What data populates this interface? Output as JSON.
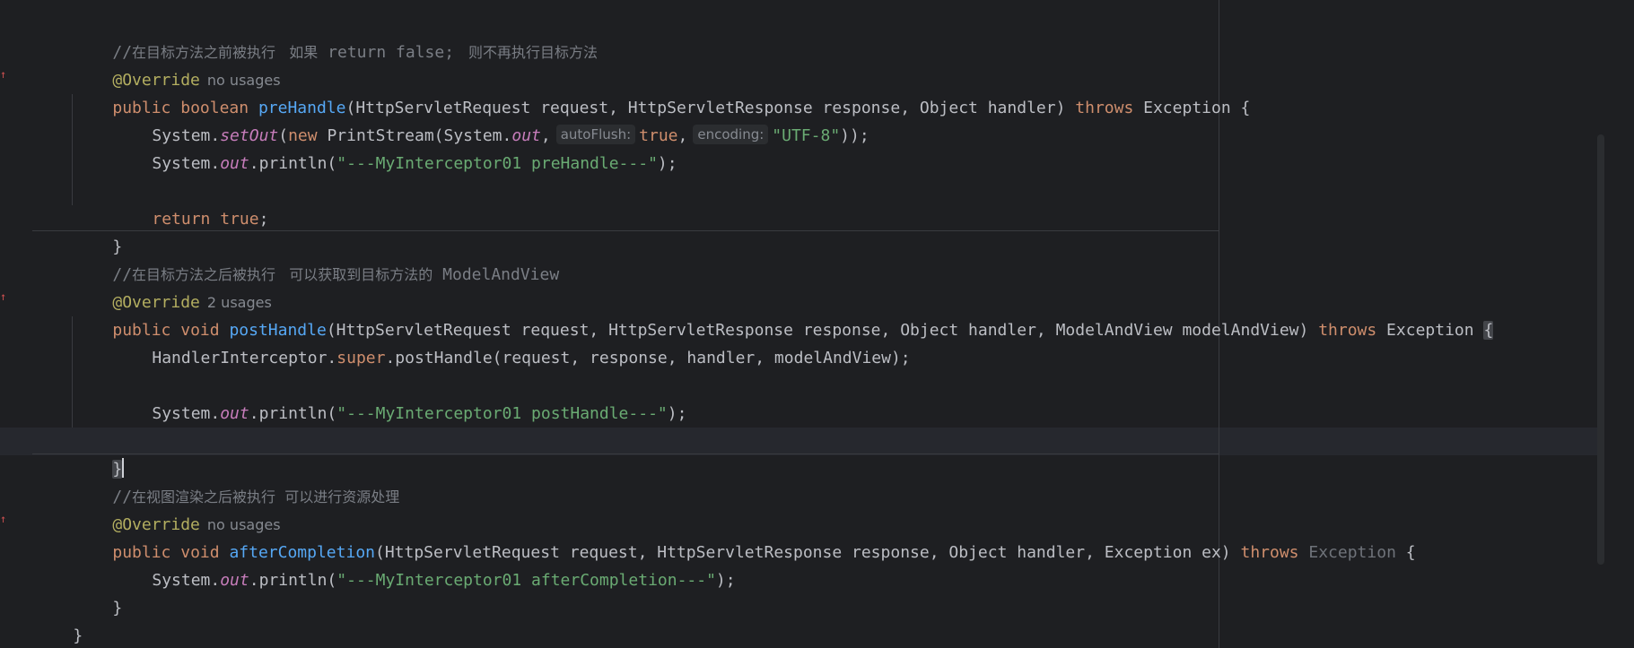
{
  "editor": {
    "lines": {
      "l1_comment_slashes": "//",
      "l1_comment_a": "在目标方法之前被执行   如果",
      "l1_comment_code": " return false; ",
      "l1_comment_b": " 则不再执行目标方法",
      "l2_annotation": "@Override",
      "l2_usage": "no usages",
      "l3_kw_public": "public",
      "l3_kw_boolean": "boolean",
      "l3_method": "preHandle",
      "l3_params": "(HttpServletRequest request, HttpServletResponse response, Object handler) ",
      "l3_throws": "throws",
      "l3_tail": " Exception {",
      "l4_a": "System.",
      "l4_setout": "setOut",
      "l4_b": "(",
      "l4_new": "new",
      "l4_c": " PrintStream(System.",
      "l4_out": "out",
      "l4_d": ",",
      "l4_hint1": "autoFlush:",
      "l4_true": "true",
      "l4_e": ",",
      "l4_hint2": "encoding:",
      "l4_str": "\"UTF-8\"",
      "l4_f": "));",
      "l5_a": "System.",
      "l5_out": "out",
      "l5_b": ".println(",
      "l5_str": "\"---MyInterceptor01 preHandle---\"",
      "l5_c": ");",
      "l7_return": "return",
      "l7_true": "true",
      "l7_semi": ";",
      "l8_brace": "}",
      "l9_slashes": "//",
      "l9_comment": "在目标方法之后被执行   可以获取到目标方法的",
      "l9_code": " ModelAndView",
      "l10_annotation": "@Override",
      "l10_usage": "2 usages",
      "l11_public": "public",
      "l11_void": "void",
      "l11_method": "postHandle",
      "l11_params": "(HttpServletRequest request, HttpServletResponse response, Object handler, ModelAndView modelAndView) ",
      "l11_throws": "throws",
      "l11_tail": " Exception ",
      "l11_brace": "{",
      "l12_a": "HandlerInterceptor.",
      "l12_super": "super",
      "l12_b": ".postHandle(request, response, handler, modelAndView);",
      "l14_a": "System.",
      "l14_out": "out",
      "l14_b": ".println(",
      "l14_str": "\"---MyInterceptor01 postHandle---\"",
      "l14_c": ");",
      "l16_brace": "}",
      "l17_slashes": "//",
      "l17_comment": "在视图渲染之后被执行  可以进行资源处理",
      "l18_annotation": "@Override",
      "l18_usage": "no usages",
      "l19_public": "public",
      "l19_void": "void",
      "l19_method": "afterCompletion",
      "l19_params": "(HttpServletRequest request, HttpServletResponse response, Object handler, Exception ex) ",
      "l19_throws": "throws",
      "l19_exception": " Exception",
      "l19_tail": " {",
      "l20_a": "System.",
      "l20_out": "out",
      "l20_b": ".println(",
      "l20_str": "\"---MyInterceptor01 afterCompletion---\"",
      "l20_c": ");",
      "l21_brace": "}",
      "l22_brace": "}"
    },
    "gutter_marker_icon": "override-arrow-icon",
    "colors": {
      "background": "#1e1f22",
      "keyword": "#cf8e6d",
      "method": "#56a8f5",
      "string": "#6aab73",
      "annotation": "#b3ae60",
      "static_field": "#c77dbb",
      "comment": "#7a7e85"
    }
  }
}
